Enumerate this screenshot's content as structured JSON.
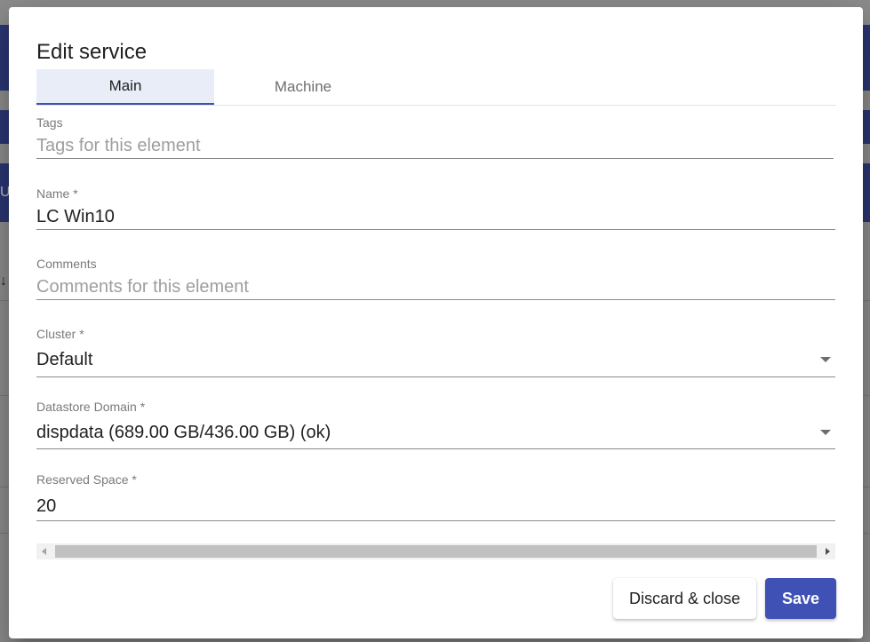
{
  "dialog": {
    "title": "Edit service",
    "tabs": [
      {
        "label": "Main",
        "active": true
      },
      {
        "label": "Machine",
        "active": false
      }
    ]
  },
  "fields": {
    "tags": {
      "label": "Tags",
      "value": "",
      "placeholder": "Tags for this element"
    },
    "name": {
      "label": "Name *",
      "value": "LC Win10",
      "placeholder": ""
    },
    "comments": {
      "label": "Comments",
      "value": "",
      "placeholder": "Comments for this element"
    },
    "cluster": {
      "label": "Cluster *",
      "selected": "Default"
    },
    "datastore_domain": {
      "label": "Datastore Domain *",
      "selected": "dispdata (689.00 GB/436.00 GB) (ok)"
    },
    "reserved_space": {
      "label": "Reserved Space *",
      "value": "20",
      "placeholder": ""
    }
  },
  "background": {
    "glyph_partial_u": "U",
    "glyph_sort_arrow": "↓"
  },
  "actions": {
    "discard_label": "Discard & close",
    "save_label": "Save"
  },
  "icons": {
    "select_caret": "caret-down-icon",
    "scroll_left": "arrow-left-icon",
    "scroll_right": "arrow-right-icon"
  },
  "colors": {
    "primary": "#3f51b5",
    "active_tab_bg": "#e9edf8",
    "background_band": "#2c3773"
  }
}
